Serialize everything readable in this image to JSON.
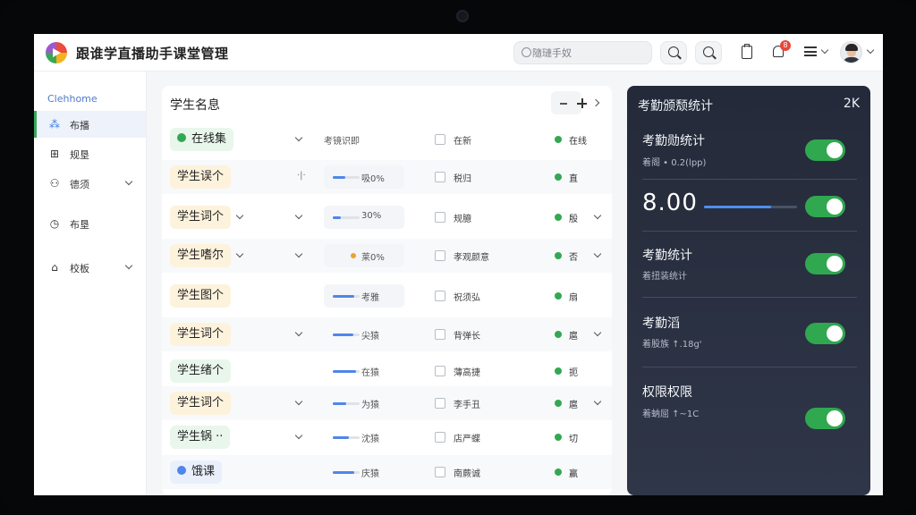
{
  "header": {
    "title": "跟谁学直播助手课堂管理",
    "search_placeholder": "隨璉手奴",
    "badge": "8",
    "icons": [
      "app-logo",
      "search-icon",
      "search-icon",
      "clipboard-icon",
      "bell-icon",
      "menu-icon",
      "avatar"
    ]
  },
  "sidebar": {
    "home": "Clehhome",
    "items": [
      {
        "label": "布播",
        "icon": "dots-icon",
        "active": true
      },
      {
        "label": "规垦",
        "icon": "grid-icon",
        "active": false
      },
      {
        "label": "德须",
        "icon": "user-icon",
        "active": false
      },
      {
        "label": "布垦",
        "icon": "clock-icon",
        "active": false
      },
      {
        "label": "校板",
        "icon": "school-icon",
        "active": false
      }
    ]
  },
  "table": {
    "title": "学生名息",
    "rows": [
      {
        "name": "在线集",
        "pill": "green",
        "progress": "考镜识即",
        "progress_style": "plain",
        "fill": 0,
        "check": "在新",
        "status": "在线",
        "caret": false
      },
      {
        "name": "学生误个",
        "pill": "orange",
        "progress": "吸0%",
        "progress_style": "box",
        "fill": 0.45,
        "check": "税归",
        "status": "直",
        "caret": false
      },
      {
        "name": "学生词个",
        "pill": "orange",
        "progress": "30%",
        "progress_style": "box",
        "fill": 0.3,
        "check": "规臆",
        "status": "殷",
        "caret": true
      },
      {
        "name": "学生嗜尔",
        "pill": "orange",
        "progress": "莱0%",
        "progress_style": "dot",
        "fill": 0,
        "check": "孝观颜意",
        "status": "否",
        "caret": true
      },
      {
        "name": "学生图个",
        "pill": "orange",
        "progress": "考雅",
        "progress_style": "box",
        "fill": 0.8,
        "check": "祝须弘",
        "status": "扇",
        "caret": false
      },
      {
        "name": "学生词个",
        "pill": "orange",
        "progress": "尖猿",
        "progress_style": "plain",
        "fill": 0.75,
        "check": "背弹长",
        "status": "扈",
        "caret": true
      },
      {
        "name": "学生绪个",
        "pill": "green",
        "progress": "在猿",
        "progress_style": "plain",
        "fill": 0.85,
        "check": "薄高捷",
        "status": "扼",
        "caret": false
      },
      {
        "name": "学生词个",
        "pill": "orange",
        "progress": "为猿",
        "progress_style": "plain",
        "fill": 0.5,
        "check": "李手丑",
        "status": "扈",
        "caret": true
      },
      {
        "name": "学生锅 ··",
        "pill": "green",
        "progress": "沈猿",
        "progress_style": "plain",
        "fill": 0.6,
        "check": "店严蝶",
        "status": "切",
        "caret": false
      },
      {
        "name": "饿课",
        "pill": "blue",
        "progress": "庆猿",
        "progress_style": "plain",
        "fill": 0.8,
        "check": "南蕨诚",
        "status": "赢",
        "caret": false
      }
    ]
  },
  "stats": {
    "title": "考勤颁颓统计",
    "value": "2K",
    "items": [
      {
        "title": "考勤勋统计",
        "sub": "着阁 • 0.2(lpp)",
        "on": true
      },
      {
        "title": "8.00",
        "sub": "",
        "slider": 0.72,
        "on": true
      },
      {
        "title": "考勤统计",
        "sub": "着扭装统计",
        "on": true
      },
      {
        "title": "考勤滔",
        "sub": "着股族 ↑.18g'",
        "on": true
      },
      {
        "title": "权限权限",
        "sub": "着蚋屈 ↑~1C",
        "on": true
      }
    ]
  },
  "colors": {
    "accent": "#32a852",
    "primary": "#4f86e8",
    "panel": "#242a39",
    "badge": "#e8473a"
  }
}
